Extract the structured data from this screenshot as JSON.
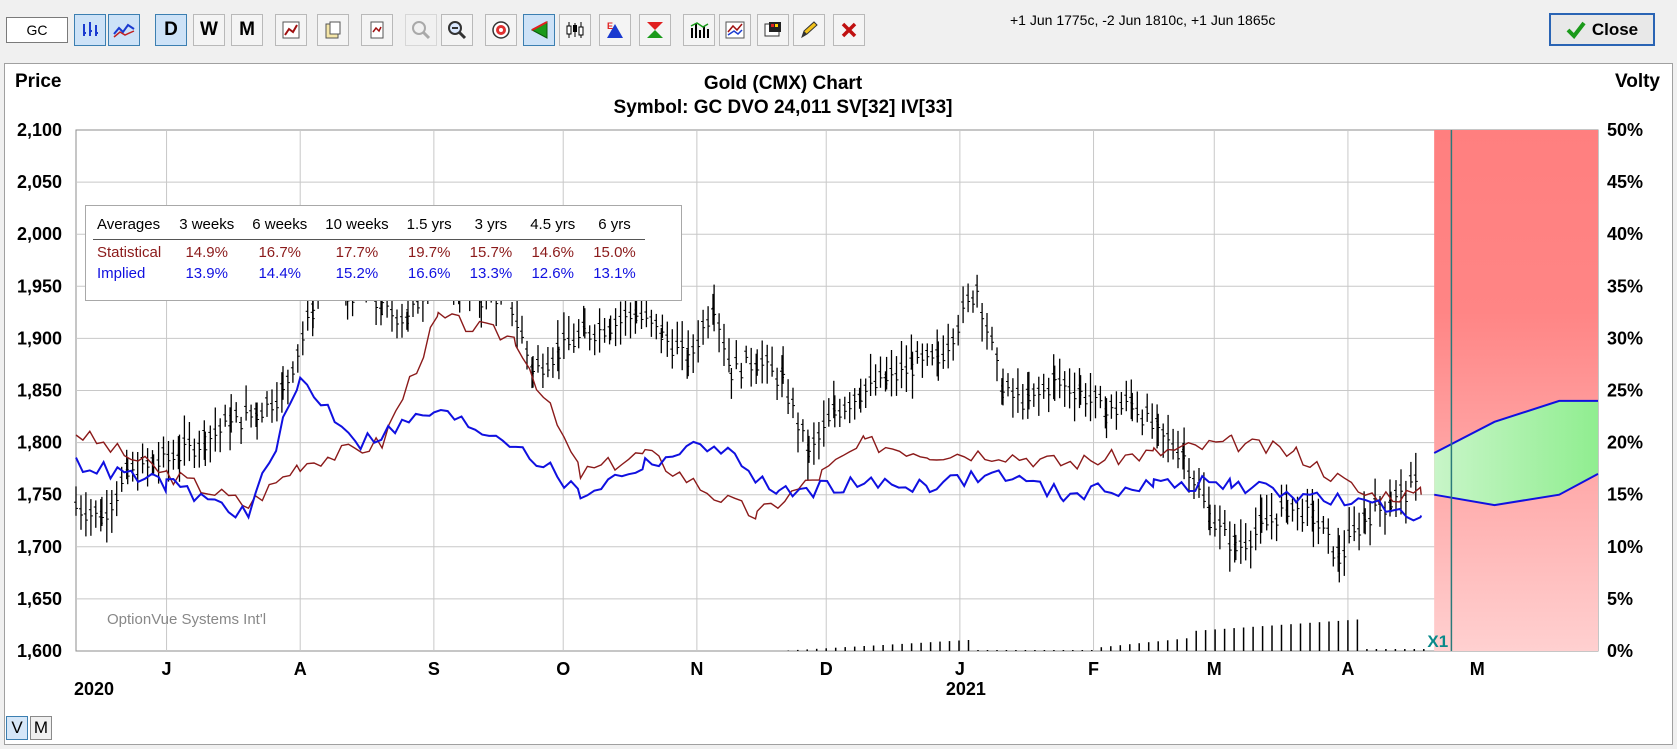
{
  "toolbar": {
    "symbol": "GC",
    "quote": "+1 Jun 1775c, -2 Jun 1810c, +1 Jun 1865c",
    "close_label": "Close",
    "buttons": [
      {
        "name": "bar-chart-icon",
        "icon": "bars",
        "active": true
      },
      {
        "name": "line-chart-icon",
        "icon": "lines",
        "active": true
      },
      {
        "name": "daily-button",
        "label": "D",
        "active": true
      },
      {
        "name": "weekly-button",
        "label": "W"
      },
      {
        "name": "monthly-button",
        "label": "M"
      },
      {
        "name": "chart-settings-icon",
        "icon": "settings"
      },
      {
        "name": "paste-icon",
        "icon": "paste"
      },
      {
        "name": "print-icon",
        "icon": "print"
      },
      {
        "name": "zoom-in-icon",
        "icon": "zoomin",
        "disabled": true
      },
      {
        "name": "zoom-out-icon",
        "icon": "zoomout"
      },
      {
        "name": "target-icon",
        "icon": "target"
      },
      {
        "name": "arrow-green-icon",
        "icon": "arrow",
        "active": true
      },
      {
        "name": "candlestick-icon",
        "icon": "candle"
      },
      {
        "name": "earnings-icon",
        "icon": "earn"
      },
      {
        "name": "dividend-icon",
        "icon": "div"
      },
      {
        "name": "volume-bars-icon",
        "icon": "vol"
      },
      {
        "name": "indicator-icon",
        "icon": "ind"
      },
      {
        "name": "palette-icon",
        "icon": "palette"
      },
      {
        "name": "pencil-icon",
        "icon": "pencil"
      },
      {
        "name": "delete-drawing-icon",
        "icon": "x"
      }
    ]
  },
  "chart": {
    "left_axis_title": "Price",
    "right_axis_title": "Volty",
    "title": "Gold (CMX) Chart",
    "subtitle": "Symbol: GC  DVO 24,011   SV[32]  IV[33]",
    "watermark": "OptionVue Systems Int'l",
    "expiry_marker": "X1",
    "price_ticks": [
      "2,100",
      "2,050",
      "2,000",
      "1,950",
      "1,900",
      "1,850",
      "1,800",
      "1,750",
      "1,700",
      "1,650",
      "1,600"
    ],
    "volty_ticks": [
      "50%",
      "45%",
      "40%",
      "35%",
      "30%",
      "25%",
      "20%",
      "15%",
      "10%",
      "5%",
      "0%"
    ],
    "month_labels": [
      "J",
      "A",
      "S",
      "O",
      "N",
      "D",
      "J",
      "F",
      "M",
      "A",
      "M"
    ],
    "year_labels": [
      "2020",
      "2021"
    ],
    "colors": {
      "statistical": "#8b1a1a",
      "implied": "#1010e0",
      "price": "#000000",
      "forecast_red": "#ff8080",
      "forecast_green": "#a8f0a8"
    }
  },
  "averages": {
    "header": [
      "Averages",
      "3 weeks",
      "6 weeks",
      "10 weeks",
      "1.5 yrs",
      "3 yrs",
      "4.5 yrs",
      "6 yrs"
    ],
    "statistical": [
      "Statistical",
      "14.9%",
      "16.7%",
      "17.7%",
      "19.7%",
      "15.7%",
      "14.6%",
      "15.0%"
    ],
    "implied": [
      "Implied",
      "13.9%",
      "14.4%",
      "15.2%",
      "16.6%",
      "13.3%",
      "12.6%",
      "13.1%"
    ]
  },
  "view_toggle": {
    "v_label": "V",
    "m_label": "M"
  },
  "chart_data": {
    "type": "line",
    "title": "Gold (CMX) Chart",
    "subtitle": "Symbol: GC  DVO 24,011   SV[32]  IV[33]",
    "ylabel": "Price",
    "y2label": "Volty",
    "ylim": [
      1600,
      2100
    ],
    "y2lim": [
      0,
      50
    ],
    "x_start": "2020-06-10",
    "x_end": "2021-05-29",
    "price_bars": [
      [
        "2020-06-10",
        1740
      ],
      [
        "2020-06-16",
        1730
      ],
      [
        "2020-06-22",
        1770
      ],
      [
        "2020-06-28",
        1780
      ],
      [
        "2020-07-04",
        1790
      ],
      [
        "2020-07-10",
        1805
      ],
      [
        "2020-07-16",
        1820
      ],
      [
        "2020-07-22",
        1830
      ],
      [
        "2020-07-28",
        1850
      ],
      [
        "2020-08-04",
        1930
      ],
      [
        "2020-08-07",
        1990
      ],
      [
        "2020-08-12",
        1940
      ],
      [
        "2020-08-14",
        1950
      ],
      [
        "2020-08-20",
        1930
      ],
      [
        "2020-08-26",
        1920
      ],
      [
        "2020-09-01",
        1965
      ],
      [
        "2020-09-07",
        1950
      ],
      [
        "2020-09-12",
        1940
      ],
      [
        "2020-09-18",
        1945
      ],
      [
        "2020-09-24",
        1870
      ],
      [
        "2020-09-30",
        1890
      ],
      [
        "2020-10-06",
        1905
      ],
      [
        "2020-10-12",
        1915
      ],
      [
        "2020-10-18",
        1925
      ],
      [
        "2020-10-24",
        1905
      ],
      [
        "2020-10-30",
        1880
      ],
      [
        "2020-11-05",
        1935
      ],
      [
        "2020-11-09",
        1870
      ],
      [
        "2020-11-15",
        1880
      ],
      [
        "2020-11-21",
        1860
      ],
      [
        "2020-11-27",
        1790
      ],
      [
        "2020-12-03",
        1830
      ],
      [
        "2020-12-09",
        1850
      ],
      [
        "2020-12-15",
        1860
      ],
      [
        "2020-12-21",
        1875
      ],
      [
        "2020-12-27",
        1880
      ],
      [
        "2021-01-05",
        1950
      ],
      [
        "2021-01-11",
        1850
      ],
      [
        "2021-01-17",
        1840
      ],
      [
        "2021-01-23",
        1860
      ],
      [
        "2021-01-29",
        1850
      ],
      [
        "2021-02-04",
        1830
      ],
      [
        "2021-02-10",
        1840
      ],
      [
        "2021-02-16",
        1810
      ],
      [
        "2021-02-22",
        1790
      ],
      [
        "2021-02-28",
        1730
      ],
      [
        "2021-03-06",
        1700
      ],
      [
        "2021-03-12",
        1720
      ],
      [
        "2021-03-18",
        1740
      ],
      [
        "2021-03-24",
        1730
      ],
      [
        "2021-03-30",
        1690
      ],
      [
        "2021-04-05",
        1730
      ],
      [
        "2021-04-11",
        1745
      ],
      [
        "2021-04-17",
        1760
      ]
    ],
    "series": [
      {
        "name": "Statistical",
        "values": [
          [
            "2020-06-10",
            21
          ],
          [
            "2020-07-01",
            17
          ],
          [
            "2020-07-20",
            14
          ],
          [
            "2020-08-01",
            18
          ],
          [
            "2020-08-20",
            20
          ],
          [
            "2020-09-02",
            32
          ],
          [
            "2020-09-20",
            30
          ],
          [
            "2020-10-05",
            17
          ],
          [
            "2020-10-20",
            19
          ],
          [
            "2020-11-05",
            15
          ],
          [
            "2020-11-15",
            13
          ],
          [
            "2020-11-30",
            17
          ],
          [
            "2020-12-10",
            20
          ],
          [
            "2020-12-25",
            19
          ],
          [
            "2021-01-10",
            19
          ],
          [
            "2021-01-25",
            18
          ],
          [
            "2021-02-15",
            19
          ],
          [
            "2021-03-05",
            20
          ],
          [
            "2021-03-20",
            19
          ],
          [
            "2021-04-05",
            15
          ],
          [
            "2021-04-18",
            15
          ]
        ]
      },
      {
        "name": "Implied",
        "values": [
          [
            "2020-06-10",
            18
          ],
          [
            "2020-07-01",
            16
          ],
          [
            "2020-07-20",
            13
          ],
          [
            "2020-08-01",
            26
          ],
          [
            "2020-08-15",
            20
          ],
          [
            "2020-09-01",
            23
          ],
          [
            "2020-09-20",
            20
          ],
          [
            "2020-10-05",
            15
          ],
          [
            "2020-10-20",
            18
          ],
          [
            "2020-11-05",
            20
          ],
          [
            "2020-11-20",
            15
          ],
          [
            "2020-12-05",
            16
          ],
          [
            "2020-12-25",
            16
          ],
          [
            "2021-01-10",
            17
          ],
          [
            "2021-01-25",
            15
          ],
          [
            "2021-02-15",
            16
          ],
          [
            "2021-03-05",
            16
          ],
          [
            "2021-03-20",
            15
          ],
          [
            "2021-04-05",
            14
          ],
          [
            "2021-04-18",
            13
          ]
        ]
      }
    ],
    "forecast": {
      "start": "2021-04-21",
      "end": "2021-05-29",
      "expiry": "2021-04-25",
      "upper": [
        [
          "2021-04-21",
          19
        ],
        [
          "2021-05-05",
          22
        ],
        [
          "2021-05-20",
          24
        ],
        [
          "2021-05-29",
          24
        ]
      ],
      "lower": [
        [
          "2021-04-21",
          15
        ],
        [
          "2021-05-05",
          14
        ],
        [
          "2021-05-20",
          15
        ],
        [
          "2021-05-29",
          17
        ]
      ]
    }
  }
}
